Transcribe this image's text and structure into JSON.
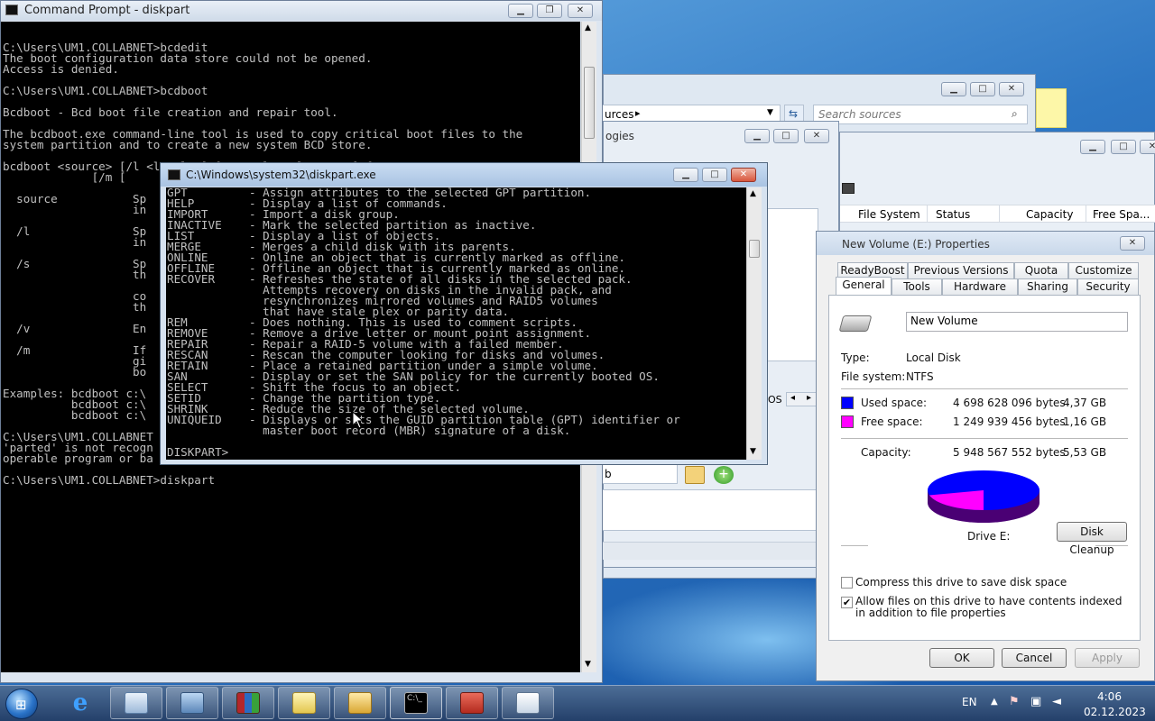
{
  "cmd_window": {
    "title": "Command Prompt - diskpart",
    "lines": [
      "",
      "C:\\Users\\UM1.COLLABNET>bcdedit",
      "The boot configuration data store could not be opened.",
      "Access is denied.",
      "",
      "C:\\Users\\UM1.COLLABNET>bcdboot",
      "",
      "Bcdboot - Bcd boot file creation and repair tool.",
      "",
      "The bcdboot.exe command-line tool is used to copy critical boot files to the",
      "system partition and to create a new system BCD store.",
      "",
      "bcdboot <source> [/l <locale>] [/s <volume-letter> [/f",
      "             [/m [",
      "",
      "  source           Sp",
      "                   in",
      "",
      "  /l               Sp",
      "                   in",
      "",
      "  /s               Sp",
      "                   th",
      "",
      "                   co",
      "                   th",
      "",
      "  /v               En",
      "",
      "  /m               If",
      "                   gi",
      "                   bo",
      "",
      "Examples: bcdboot c:\\",
      "          bcdboot c:\\",
      "          bcdboot c:\\",
      "",
      "C:\\Users\\UM1.COLLABNET",
      "'parted' is not recogn",
      "operable program or ba",
      "",
      "C:\\Users\\UM1.COLLABNET>diskpart"
    ]
  },
  "diskpart_window": {
    "title": "C:\\Windows\\system32\\diskpart.exe",
    "lines": [
      "GPT         - Assign attributes to the selected GPT partition.",
      "HELP        - Display a list of commands.",
      "IMPORT      - Import a disk group.",
      "INACTIVE    - Mark the selected partition as inactive.",
      "LIST        - Display a list of objects.",
      "MERGE       - Merges a child disk with its parents.",
      "ONLINE      - Online an object that is currently marked as offline.",
      "OFFLINE     - Offline an object that is currently marked as online.",
      "RECOVER     - Refreshes the state of all disks in the selected pack.",
      "              Attempts recovery on disks in the invalid pack, and",
      "              resynchronizes mirrored volumes and RAID5 volumes",
      "              that have stale plex or parity data.",
      "REM         - Does nothing. This is used to comment scripts.",
      "REMOVE      - Remove a drive letter or mount point assignment.",
      "REPAIR      - Repair a RAID-5 volume with a failed member.",
      "RESCAN      - Rescan the computer looking for disks and volumes.",
      "RETAIN      - Place a retained partition under a simple volume.",
      "SAN         - Display or set the SAN policy for the currently booted OS.",
      "SELECT      - Shift the focus to an object.",
      "SETID       - Change the partition type.",
      "SHRINK      - Reduce the size of the selected volume.",
      "UNIQUEID    - Displays or sets the GUID partition table (GPT) identifier or",
      "              master boot record (MBR) signature of a disk.",
      "",
      "DISKPART>"
    ]
  },
  "bg_windows": {
    "sources_crumb": "urces",
    "search_placeholder": "Search sources",
    "logies_text": "ogies",
    "os_text": "OS",
    "b_text": "b",
    "columns": [
      "File System",
      "Status",
      "Capacity",
      "Free Spa..."
    ]
  },
  "properties": {
    "title": "New Volume (E:) Properties",
    "tabs_row1": [
      "ReadyBoost",
      "Previous Versions",
      "Quota",
      "Customize"
    ],
    "tabs_row2": [
      "General",
      "Tools",
      "Hardware",
      "Sharing",
      "Security"
    ],
    "volume_name": "New Volume",
    "type_label": "Type:",
    "type_value": "Local Disk",
    "fs_label": "File system:",
    "fs_value": "NTFS",
    "used_label": "Used space:",
    "used_bytes": "4 698 628 096 bytes",
    "used_gb": "4,37 GB",
    "free_label": "Free space:",
    "free_bytes": "1 249 939 456 bytes",
    "free_gb": "1,16 GB",
    "capacity_label": "Capacity:",
    "capacity_bytes": "5 948 567 552 bytes",
    "capacity_gb": "5,53 GB",
    "drive_label": "Drive E:",
    "disk_cleanup": "Disk Cleanup",
    "compress_label": "Compress this drive to save disk space",
    "compress_checked": false,
    "index_label": "Allow files on this drive to have contents indexed in addition to file properties",
    "index_checked": true,
    "ok": "OK",
    "cancel": "Cancel",
    "apply": "Apply",
    "used_color": "#0000ff",
    "free_color": "#ff00ff",
    "used_fraction": 0.79
  },
  "taskbar": {
    "language": "EN",
    "time": "4:06",
    "date": "02.12.2023",
    "apps": [
      "internet-explorer",
      "server-manager",
      "remote-desktop",
      "winrar",
      "windows-explorer-library",
      "file-explorer",
      "command-prompt",
      "toolbox",
      "control-panel"
    ]
  }
}
